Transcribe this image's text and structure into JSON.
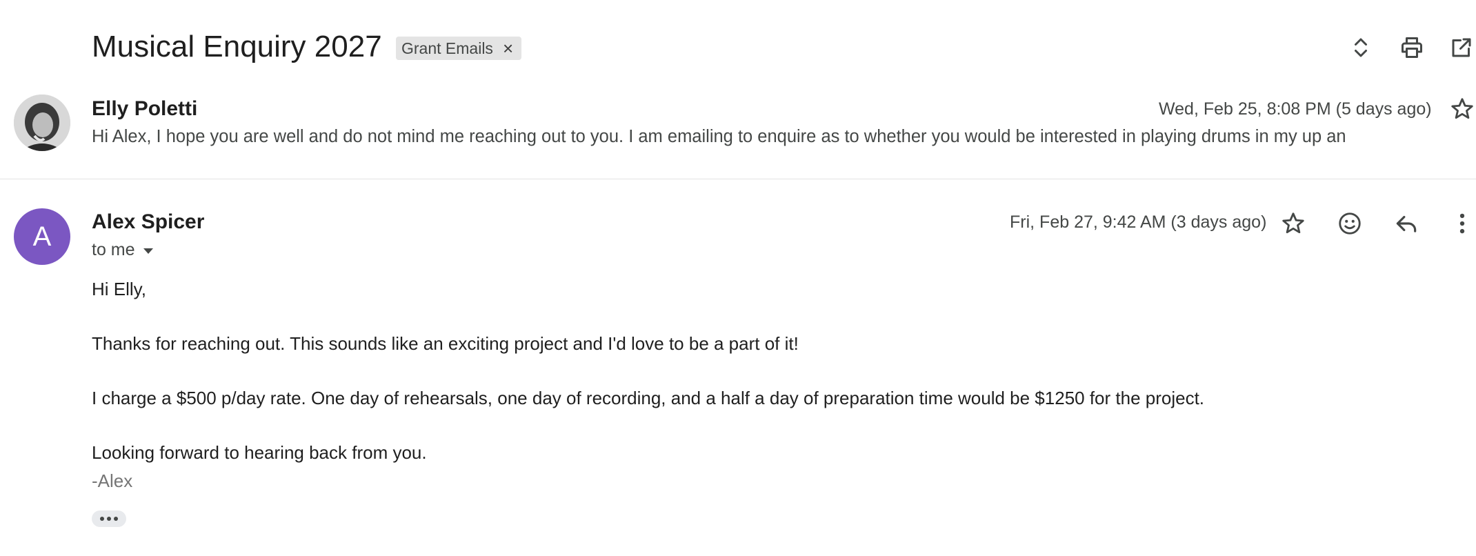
{
  "thread": {
    "subject": "Musical Enquiry 2027",
    "label": "Grant Emails",
    "label_remove": "×"
  },
  "toolbar": {
    "icons": [
      "expand-collapse-icon",
      "print-icon",
      "open-new-window-icon"
    ]
  },
  "messages": [
    {
      "sender": "Elly Poletti",
      "date": "Wed, Feb 25, 8:08 PM (5 days ago)",
      "snippet": "Hi Alex, I hope you are well and do not mind me reaching out to you. I am emailing to enquire as to whether you would be interested in playing drums in my up an",
      "avatar": "photo"
    },
    {
      "sender": "Alex Spicer",
      "avatar_letter": "A",
      "avatar_color": "#7b57c2",
      "date": "Fri, Feb 27, 9:42 AM (3 days ago)",
      "recipient": "to me",
      "body": [
        "Hi Elly,",
        "Thanks for reaching out. This sounds like an exciting project and I'd love to be a part of it!",
        "I charge a $500 p/day rate. One day of rehearsals, one day of recording, and a half a day of preparation time would be $1250 for the project.",
        "Looking forward to hearing back from you."
      ],
      "signature": "-Alex",
      "actions": [
        "star-icon",
        "emoji-reaction-icon",
        "reply-icon",
        "more-options-icon"
      ]
    }
  ]
}
